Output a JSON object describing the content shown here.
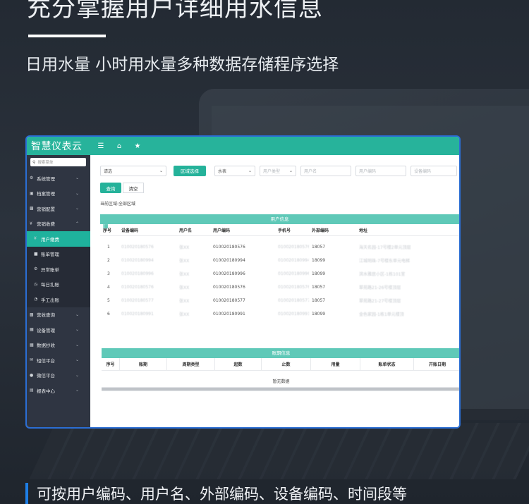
{
  "promo": {
    "headline": "充分掌握用户详细用水信息",
    "subline": "日用水量  小时用水量多种数据存储程序选择",
    "bottom_note": "可按用户编码、用户名、外部编码、设备编码、时间段等"
  },
  "app": {
    "title": "智慧仪表云",
    "accent_color": "#27b39b",
    "sidebar": {
      "search_placeholder": "搜索菜单",
      "items": [
        {
          "label": "系统管理",
          "icon": "gear-icon"
        },
        {
          "label": "档案管理",
          "icon": "file-icon"
        },
        {
          "label": "营销配置",
          "icon": "card-icon"
        },
        {
          "label": "营销收费",
          "icon": "yen-icon"
        }
      ],
      "sub_items": [
        {
          "label": "用户缴费",
          "icon": "yen-icon",
          "active": true
        },
        {
          "label": "账单管理",
          "icon": "lock-icon"
        },
        {
          "label": "异常账单",
          "icon": "gear-icon"
        },
        {
          "label": "每日扎帐",
          "icon": "clock-icon"
        },
        {
          "label": "手工出账",
          "icon": "pie-icon"
        }
      ],
      "items_after": [
        {
          "label": "营收查询",
          "icon": "card-icon"
        },
        {
          "label": "设备管理",
          "icon": "grid-icon"
        },
        {
          "label": "数据抄收",
          "icon": "grid-icon"
        },
        {
          "label": "短信平台",
          "icon": "mail-icon"
        },
        {
          "label": "微信平台",
          "icon": "wechat-icon"
        },
        {
          "label": "报表中心",
          "icon": "chart-icon"
        }
      ]
    },
    "filters": {
      "area_select": "请选",
      "area_button": "区域选择",
      "meter_type": "水表",
      "user_type_placeholder": "用户类型",
      "username_placeholder": "用户名",
      "usercode_placeholder": "用户编码",
      "devicecode_placeholder": "设备编码",
      "query_button": "查询",
      "clear_button": "清空",
      "current_area": "当前区域:全部区域"
    },
    "user_panel": {
      "title": "用户信息",
      "columns": [
        "序号",
        "设备编码",
        "用户名",
        "用户编码",
        "手机号",
        "外部编码",
        "地址"
      ],
      "rows": [
        {
          "no": "1",
          "device": "010020180576",
          "name": "张XX",
          "code": "010020180576",
          "phone": "010020180576",
          "ext": "18057",
          "addr": "海天名园-17号楼2单元顶层"
        },
        {
          "no": "2",
          "device": "010020180994",
          "name": "张XX",
          "code": "010020180994",
          "phone": "010020180994",
          "ext": "18099",
          "addr": "江城明珠-7号楼东单元电梯"
        },
        {
          "no": "3",
          "device": "010020180996",
          "name": "张XX",
          "code": "010020180996",
          "phone": "010020180996",
          "ext": "18099",
          "addr": "滨水雅居小区-1栋101室"
        },
        {
          "no": "4",
          "device": "010020180576",
          "name": "张XX",
          "code": "010020180576",
          "phone": "010020180576",
          "ext": "18057",
          "addr": "翠苑路21-26号楼顶层"
        },
        {
          "no": "5",
          "device": "010020180577",
          "name": "张XX",
          "code": "010020180577",
          "phone": "010020180577",
          "ext": "18057",
          "addr": "翠苑路21-27号楼顶层"
        },
        {
          "no": "6",
          "device": "010020180991",
          "name": "张XX",
          "code": "010020180991",
          "phone": "010020180991",
          "ext": "18099",
          "addr": "金色家园-1栋1单元楼顶"
        }
      ]
    },
    "bill_panel": {
      "title": "账期信息",
      "columns": [
        "序号",
        "账期",
        "周期类型",
        "起数",
        "止数",
        "用量",
        "账单状态",
        "开账日期"
      ],
      "empty_text": "暂无数据"
    }
  }
}
